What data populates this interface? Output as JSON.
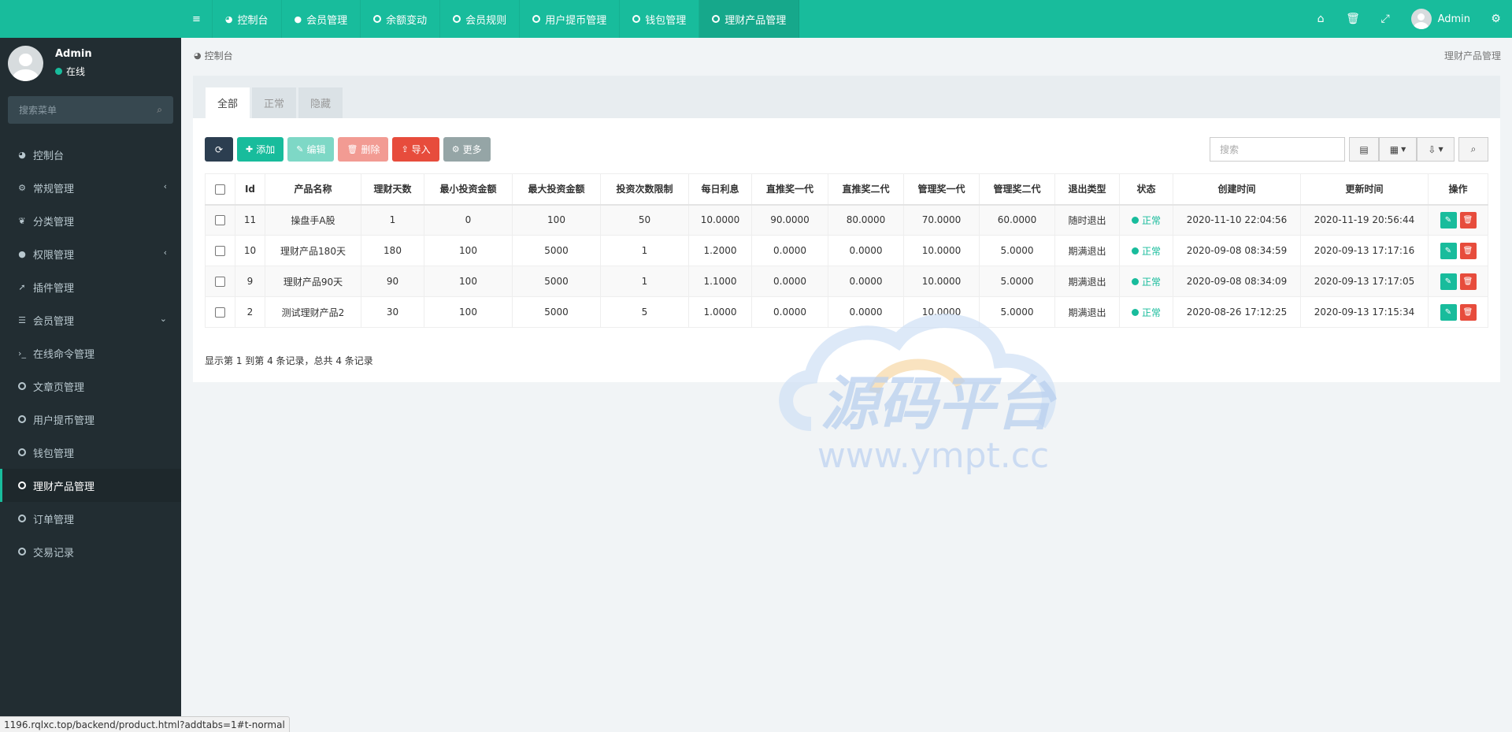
{
  "topnav": {
    "items": [
      {
        "label": "控制台",
        "icon": "dashboard-icon"
      },
      {
        "label": "会员管理",
        "icon": "user-icon"
      },
      {
        "label": "余额变动",
        "icon": "circle-icon"
      },
      {
        "label": "会员规则",
        "icon": "circle-icon"
      },
      {
        "label": "用户提币管理",
        "icon": "circle-icon"
      },
      {
        "label": "钱包管理",
        "icon": "circle-icon"
      },
      {
        "label": "理财产品管理",
        "icon": "circle-icon",
        "active": true
      }
    ],
    "user_name": "Admin"
  },
  "sidebar": {
    "user_name": "Admin",
    "status": "在线",
    "search_placeholder": "搜索菜单",
    "items": [
      {
        "label": "控制台",
        "icon": "dashboard-icon"
      },
      {
        "label": "常规管理",
        "icon": "cogs-icon",
        "chevron": "‹"
      },
      {
        "label": "分类管理",
        "icon": "leaf-icon"
      },
      {
        "label": "权限管理",
        "icon": "group-icon",
        "chevron": "‹"
      },
      {
        "label": "插件管理",
        "icon": "rocket-icon"
      },
      {
        "label": "会员管理",
        "icon": "list-icon",
        "chevron": "⌄"
      },
      {
        "label": "在线命令管理",
        "icon": "terminal-icon"
      },
      {
        "label": "文章页管理",
        "icon": "circle-icon"
      },
      {
        "label": "用户提币管理",
        "icon": "circle-icon"
      },
      {
        "label": "钱包管理",
        "icon": "circle-icon"
      },
      {
        "label": "理财产品管理",
        "icon": "circle-icon",
        "active": true
      },
      {
        "label": "订单管理",
        "icon": "circle-icon"
      },
      {
        "label": "交易记录",
        "icon": "circle-icon"
      }
    ]
  },
  "breadcrumb": {
    "left": "控制台",
    "right": "理财产品管理"
  },
  "tabs": [
    "全部",
    "正常",
    "隐藏"
  ],
  "toolbar": {
    "add": "添加",
    "edit": "编辑",
    "delete": "删除",
    "import": "导入",
    "more": "更多",
    "search_placeholder": "搜索"
  },
  "table": {
    "headers": [
      "Id",
      "产品名称",
      "理财天数",
      "最小投资金额",
      "最大投资金额",
      "投资次数限制",
      "每日利息",
      "直推奖一代",
      "直推奖二代",
      "管理奖一代",
      "管理奖二代",
      "退出类型",
      "状态",
      "创建时间",
      "更新时间",
      "操作"
    ],
    "rows": [
      {
        "id": "11",
        "name": "操盘手A股",
        "days": "1",
        "min": "0",
        "max": "100",
        "limit": "50",
        "interest": "10.0000",
        "d1": "90.0000",
        "d2": "80.0000",
        "m1": "70.0000",
        "m2": "60.0000",
        "exit": "随时退出",
        "status": "正常",
        "created": "2020-11-10 22:04:56",
        "updated": "2020-11-19 20:56:44"
      },
      {
        "id": "10",
        "name": "理财产品180天",
        "days": "180",
        "min": "100",
        "max": "5000",
        "limit": "1",
        "interest": "1.2000",
        "d1": "0.0000",
        "d2": "0.0000",
        "m1": "10.0000",
        "m2": "5.0000",
        "exit": "期满退出",
        "status": "正常",
        "created": "2020-09-08 08:34:59",
        "updated": "2020-09-13 17:17:16"
      },
      {
        "id": "9",
        "name": "理财产品90天",
        "days": "90",
        "min": "100",
        "max": "5000",
        "limit": "1",
        "interest": "1.1000",
        "d1": "0.0000",
        "d2": "0.0000",
        "m1": "10.0000",
        "m2": "5.0000",
        "exit": "期满退出",
        "status": "正常",
        "created": "2020-09-08 08:34:09",
        "updated": "2020-09-13 17:17:05"
      },
      {
        "id": "2",
        "name": "测试理财产品2",
        "days": "30",
        "min": "100",
        "max": "5000",
        "limit": "5",
        "interest": "1.0000",
        "d1": "0.0000",
        "d2": "0.0000",
        "m1": "10.0000",
        "m2": "5.0000",
        "exit": "期满退出",
        "status": "正常",
        "created": "2020-08-26 17:12:25",
        "updated": "2020-09-13 17:15:34"
      }
    ]
  },
  "pageinfo": "显示第 1 到第 4 条记录，总共 4 条记录",
  "watermark": {
    "title": "源码平台",
    "url": "www.ympt.cc"
  },
  "statusbar_url": "1196.rqlxc.top/backend/product.html?addtabs=1#t-normal",
  "colors": {
    "primary": "#18bc9c",
    "sidebar": "#222d32",
    "danger": "#e74c3c",
    "dark": "#2c3e50"
  }
}
